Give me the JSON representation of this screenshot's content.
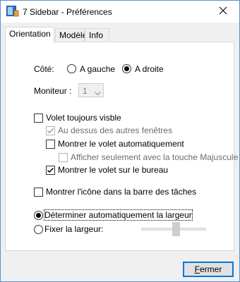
{
  "window": {
    "title": "7 Sidebar - Préférences"
  },
  "tabs": [
    {
      "label": "Orientation",
      "active": true
    },
    {
      "label": "Modèle",
      "active": false
    },
    {
      "label": "Info",
      "active": false
    }
  ],
  "orientation": {
    "side_label": "Côté:",
    "left_option": "A gauche",
    "right_option": "A droite",
    "selected_side": "A droite",
    "monitor_label": "Moniteur :",
    "monitor_value": "1"
  },
  "options": {
    "always_visible": {
      "label": "Volet toujours visble",
      "checked": false
    },
    "above_windows": {
      "label": "Au dessus des autres fenêtres",
      "checked": true,
      "disabled": true
    },
    "auto_show": {
      "label": "Montrer le volet automatiquement",
      "checked": false
    },
    "shift_only": {
      "label": "Afficher seulement avec la touche Majuscule",
      "checked": false,
      "disabled": true
    },
    "show_on_desktop": {
      "label": "Montrer le volet sur le bureau",
      "checked": true
    },
    "taskbar_icon": {
      "label": "Montrer l'icône dans la barre des tâches",
      "checked": false
    }
  },
  "width": {
    "auto_label": "Déterminer automatiquement la largeur",
    "fixed_label": "Fixer la largeur:",
    "selected": "auto",
    "slider_level": 0.5
  },
  "footer": {
    "close_label_first": "F",
    "close_label_rest": "ermer"
  },
  "colors": {
    "accent": "#0078d7",
    "window_border": "#5a8fd8",
    "panel_bg": "#ffffff",
    "dialog_bg": "#f0f0f0"
  }
}
